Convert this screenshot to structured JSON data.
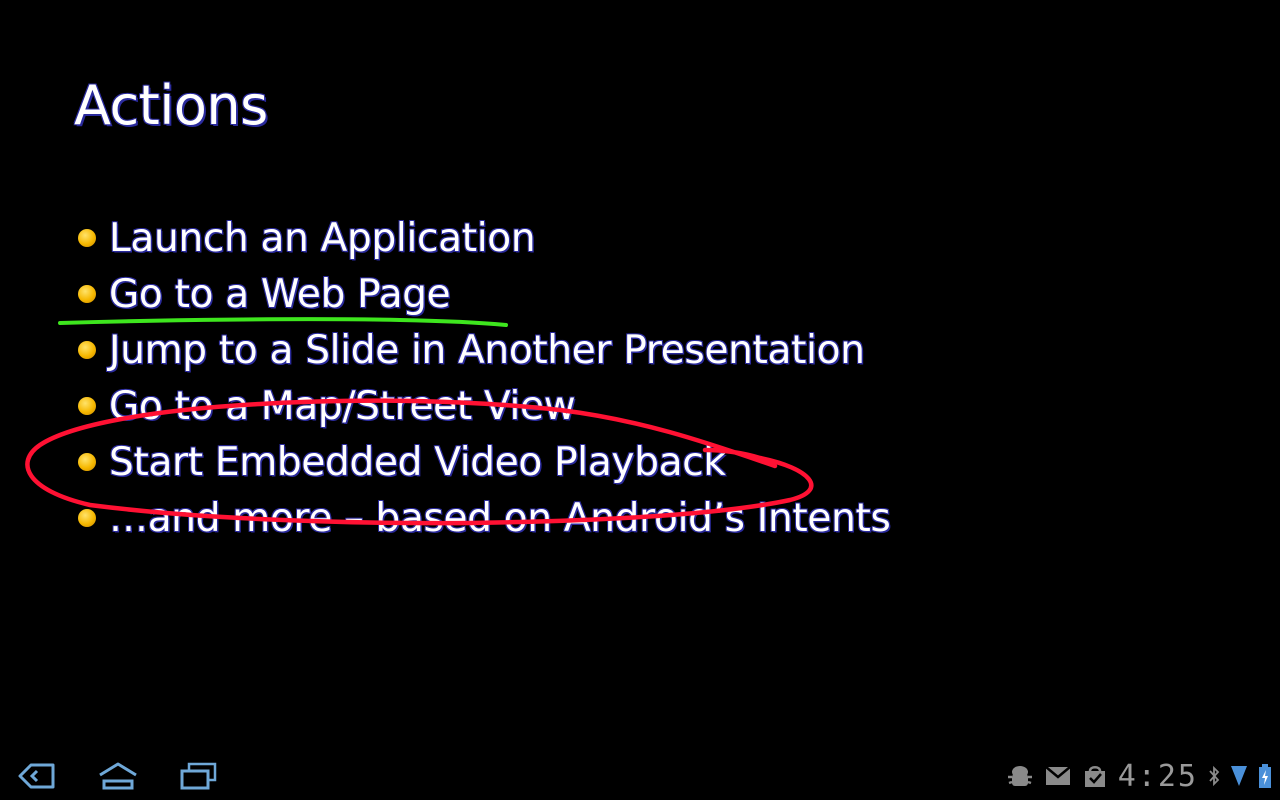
{
  "slide": {
    "title": "Actions",
    "bullets": [
      "Launch an Application",
      "Go to a Web Page",
      "Jump to a Slide in Another Presentation",
      "Go to a Map/Street View",
      "Start Embedded Video Playback",
      "…and more – based on Android’s Intents"
    ]
  },
  "annotations": {
    "underline_color": "#3ee61e",
    "circle_color": "#ff1133"
  },
  "colors": {
    "background": "#000000",
    "bullet_dot": "#f6b800",
    "text_outline": "#2a2a9c"
  },
  "system_bar": {
    "clock": "4:25",
    "nav_icons": [
      "back-icon",
      "home-icon",
      "recent-apps-icon"
    ],
    "status_icons": [
      "android-debug-icon",
      "gmail-icon",
      "market-download-icon",
      "bluetooth-icon",
      "wifi-signal-icon",
      "battery-charging-icon"
    ]
  }
}
